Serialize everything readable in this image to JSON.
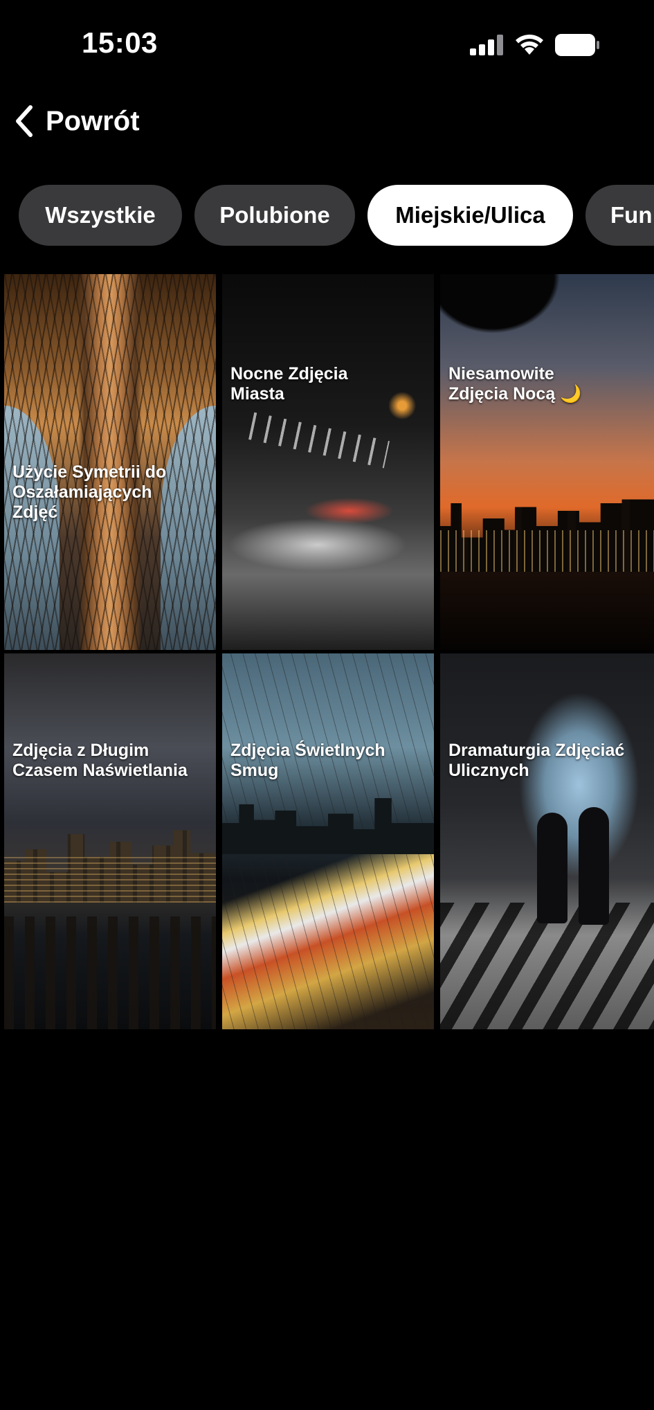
{
  "status_bar": {
    "time": "15:03",
    "icons": [
      "signal-icon",
      "wifi-icon",
      "battery-icon"
    ]
  },
  "nav": {
    "back_label": "Powrót"
  },
  "filters": {
    "chips": [
      {
        "label": "Wszystkie",
        "active": false
      },
      {
        "label": "Polubione",
        "active": false
      },
      {
        "label": "Miejskie/Ulica",
        "active": true
      },
      {
        "label": "Fun",
        "active": false
      }
    ]
  },
  "cards": [
    {
      "title": "Użycie Symetrii do Oszałamiających Zdjęć"
    },
    {
      "title": "Nocne Zdjęcia Miasta"
    },
    {
      "title": "Niesamowite Zdjęcia Nocą 🌙"
    },
    {
      "title": "Zdjęcia z Długim Czasem Naświetlania"
    },
    {
      "title": "Zdjęcia Świetlnych Smug"
    },
    {
      "title": "Dramaturgia Zdjęciać Ulicznych"
    }
  ],
  "colors": {
    "background": "#000000",
    "chip_inactive": "#3a3a3c",
    "chip_active": "#ffffff",
    "text": "#ffffff"
  }
}
